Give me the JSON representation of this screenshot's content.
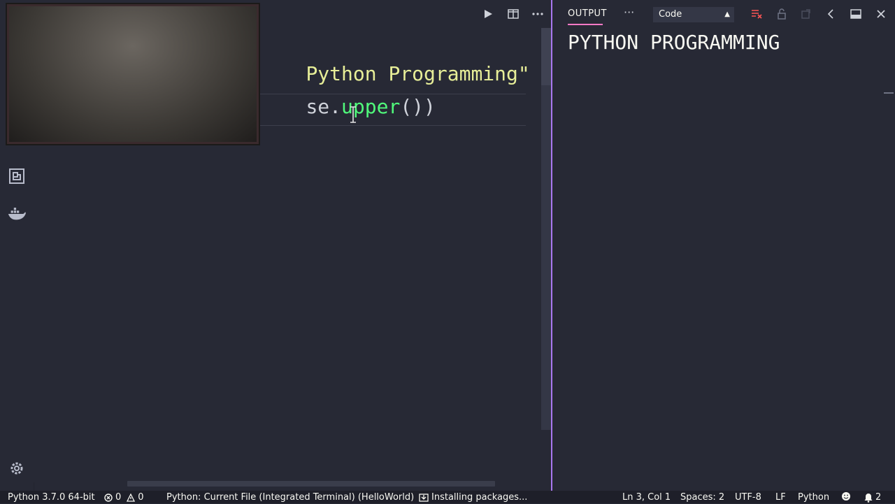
{
  "editor": {
    "code_line1_str": "Python Programming\"",
    "code_line2_obj": "se.",
    "code_line2_fn": "upper",
    "code_line2_tail": "())"
  },
  "panel": {
    "tab_label": "OUTPUT",
    "more_label": "···",
    "channel_selected": "Code",
    "output_text": "PYTHON PROGRAMMING"
  },
  "status": {
    "interpreter": "Python 3.7.0 64-bit",
    "errors": "0",
    "warnings": "0",
    "debug_config": "Python: Current File (Integrated Terminal) (HelloWorld)",
    "installing": "Installing packages...",
    "position": "Ln 3, Col 1",
    "spaces": "Spaces: 2",
    "encoding": "UTF-8",
    "eol": "LF",
    "language": "Python",
    "notifications": "2"
  },
  "colors": {
    "accent": "#a978f0",
    "string": "#e7ee98",
    "function": "#50fa7b",
    "tab_underline": "#ff79c6"
  }
}
